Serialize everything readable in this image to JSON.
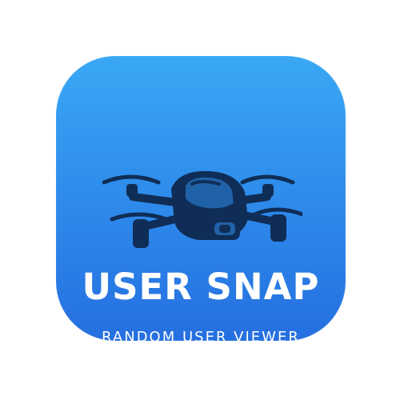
{
  "app_icon": {
    "name": "USER SNAP",
    "tagline": "RANDOM USER VIEWER",
    "illustration": "drone-icon",
    "colors": {
      "background_top": "#3aa8f4",
      "background_bottom": "#256fe0",
      "illustration": "#0f2d56",
      "text": "#ffffff"
    }
  }
}
